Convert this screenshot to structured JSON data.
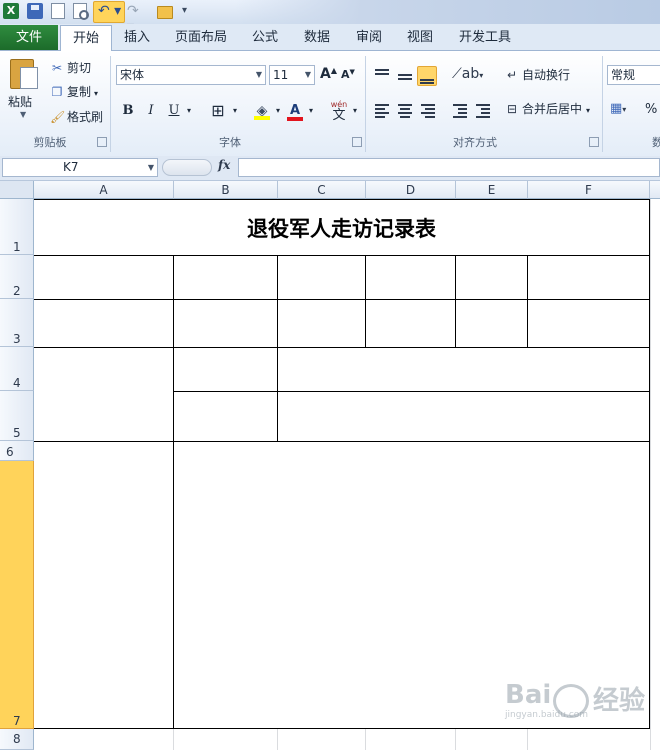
{
  "qat": {
    "excel_letter": "X"
  },
  "tabs": [
    "文件",
    "开始",
    "插入",
    "页面布局",
    "公式",
    "数据",
    "审阅",
    "视图",
    "开发工具"
  ],
  "clipboard": {
    "paste": "粘贴",
    "cut": "剪切",
    "copy": "复制",
    "format_painter": "格式刷",
    "group_label": "剪贴板"
  },
  "font": {
    "name": "宋体",
    "size": "11",
    "bold": "B",
    "italic": "I",
    "underline": "U",
    "font_color_glyph": "A",
    "phonetic": "wén",
    "phonetic_char": "文",
    "grow_glyph": "A",
    "shrink_glyph": "A",
    "group_label": "字体"
  },
  "alignment": {
    "wrap_text": "自动换行",
    "merge_center": "合并后居中",
    "group_label": "对齐方式"
  },
  "number": {
    "format": "常规",
    "percent": "%",
    "group_label_partial": "数"
  },
  "formula_bar": {
    "name_box": "K7",
    "fx": "fx"
  },
  "columns": [
    "A",
    "B",
    "C",
    "D",
    "E",
    "F"
  ],
  "rows": [
    "1",
    "2",
    "3",
    "4",
    "5",
    "6",
    "7",
    "8"
  ],
  "sheet": {
    "title": "退役军人走访记录表"
  },
  "watermark": {
    "text_left": "Bai",
    "text_right": "经验",
    "text_sub": "jingyan.baidu.com"
  },
  "colors": {
    "file_tab": "#1f7a3a",
    "selected_row": "#ffd35a",
    "ribbon_bg": "#e4edf8",
    "highlight_button": "#ffd66a"
  }
}
